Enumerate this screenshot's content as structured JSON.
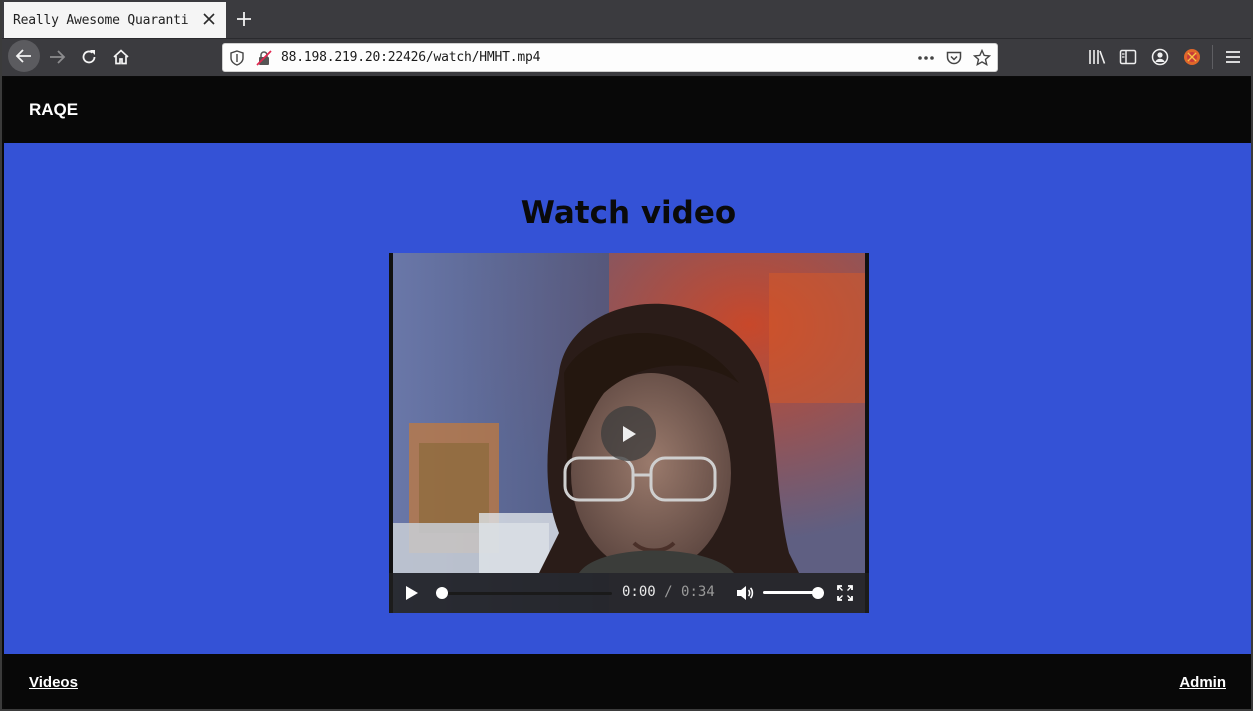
{
  "browser": {
    "tab_title": "Really Awesome Quaranti",
    "url": "88.198.219.20:22426/watch/HMHT.mp4",
    "icons": {
      "back": "back-arrow-icon",
      "forward": "forward-arrow-icon",
      "reload": "reload-icon",
      "home": "home-icon",
      "shield": "tracking-shield-icon",
      "insecure": "insecure-lock-icon",
      "more": "more-dots-icon",
      "pocket": "pocket-icon",
      "bookmark": "star-icon",
      "library": "library-icon",
      "sidebar": "sidebar-icon",
      "account": "account-icon",
      "extension": "extension-icon",
      "menu": "hamburger-menu-icon"
    }
  },
  "site": {
    "brand": "RAQE",
    "colors": {
      "header": "#080808",
      "main": "#3452d6",
      "footer": "#080808"
    }
  },
  "main": {
    "title": "Watch video"
  },
  "video": {
    "current_time": "0:00",
    "separator": "/",
    "duration": "0:34",
    "progress": 0,
    "volume": 1
  },
  "footer": {
    "videos_link": "Videos",
    "admin_link": "Admin"
  }
}
